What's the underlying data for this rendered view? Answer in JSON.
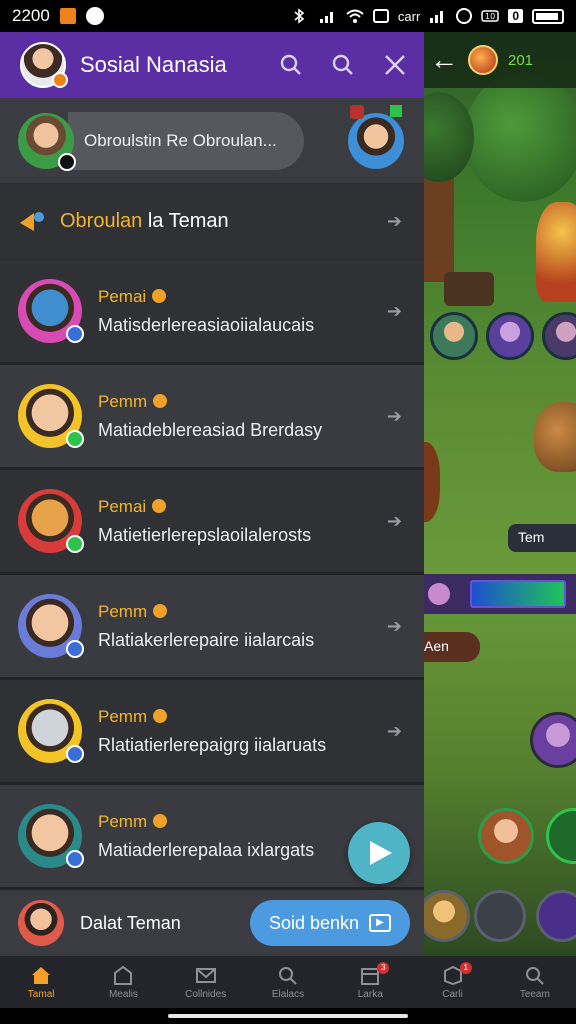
{
  "status_bar": {
    "time": "2200",
    "carrier": "carr",
    "battery_level": "0"
  },
  "app": {
    "title": "Sosial Nanasia"
  },
  "search": {
    "value": "Obroulstin Re Obroulan..."
  },
  "section": {
    "title_highlight": "Obroulan",
    "title_rest": " la Teman"
  },
  "friends": [
    {
      "name": "Pemai",
      "message": "Matisderlereasiaoiialaucais",
      "ring": "#d84bb4",
      "face": "#3f8fd0",
      "status": "blue"
    },
    {
      "name": "Pemm",
      "message": "Matiadeblereasiad Brerdasy",
      "ring": "#f2c427",
      "face": "#f2c6a0",
      "status": "green"
    },
    {
      "name": "Pemai",
      "message": "Matietierlerepslaoilalerosts",
      "ring": "#d93b3b",
      "face": "#e7a24a",
      "status": "green"
    },
    {
      "name": "Pemm",
      "message": "Rlatiakerlerepaire iialarcais",
      "ring": "#6a7bd8",
      "face": "#f2c6a0",
      "status": "blue"
    },
    {
      "name": "Pemm",
      "message": "Rlatiatierlerepaigrg iialaruats",
      "ring": "#f2c427",
      "face": "#cfd4da",
      "status": "blue"
    },
    {
      "name": "Pemm",
      "message": "Matiaderlerepalaa ixlargats",
      "ring": "#2a8a8a",
      "face": "#f2c6a0",
      "status": "blue"
    }
  ],
  "bottom": {
    "label": "Dalat Teman",
    "button": "Soid benkn"
  },
  "game": {
    "level": "201",
    "tag": "Tem",
    "an_label": "Aen"
  },
  "nav": [
    {
      "label": "Tamal",
      "icon": "home-icon",
      "active": true
    },
    {
      "label": "Mealis",
      "icon": "shop-icon"
    },
    {
      "label": "Collnides",
      "icon": "mail-icon"
    },
    {
      "label": "Elalacs",
      "icon": "search-icon"
    },
    {
      "label": "Larka",
      "icon": "calendar-icon",
      "badge": "3"
    },
    {
      "label": "Carli",
      "icon": "box-icon",
      "badge": "1"
    },
    {
      "label": "Teeam",
      "icon": "search-icon"
    }
  ],
  "colors": {
    "header": "#5b2ea4",
    "accent": "#f3b52b",
    "fab": "#4fb4c6",
    "cta": "#4c9be0"
  }
}
